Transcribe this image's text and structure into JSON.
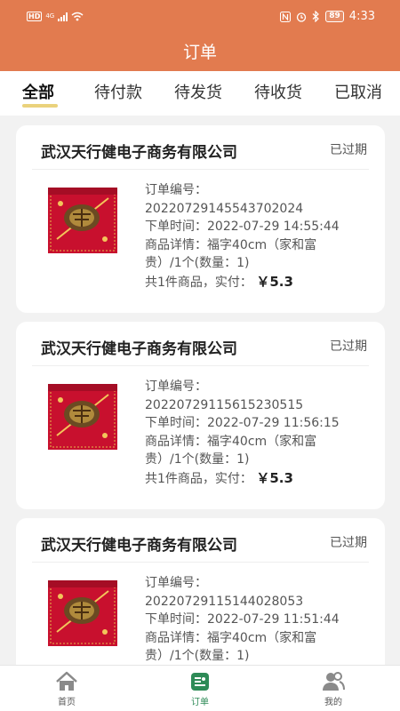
{
  "statusbar": {
    "network_badge": "HD",
    "network_type": "4G",
    "battery": "89",
    "time": "4:33"
  },
  "header": {
    "title": "订单"
  },
  "tabs": [
    {
      "label": "全部",
      "active": true
    },
    {
      "label": "待付款",
      "active": false
    },
    {
      "label": "待发货",
      "active": false
    },
    {
      "label": "待收货",
      "active": false
    },
    {
      "label": "已取消",
      "active": false
    }
  ],
  "orders": [
    {
      "shop": "武汉天行健电子商务有限公司",
      "status": "已过期",
      "order_no_label": "订单编号：",
      "order_no": "20220729145543702024",
      "time_label": "下单时间：",
      "time": "2022-07-29 14:55:44",
      "detail_label": "商品详情：",
      "detail_line1": "福字40cm（家和富",
      "detail_line2": "贵）/1个(数量：1)",
      "summary_label": "共1件商品，实付：",
      "price": "￥5.3"
    },
    {
      "shop": "武汉天行健电子商务有限公司",
      "status": "已过期",
      "order_no_label": "订单编号：",
      "order_no": "20220729115615230515",
      "time_label": "下单时间：",
      "time": "2022-07-29 11:56:15",
      "detail_label": "商品详情：",
      "detail_line1": "福字40cm（家和富",
      "detail_line2": "贵）/1个(数量：1)",
      "summary_label": "共1件商品，实付：",
      "price": "￥5.3"
    },
    {
      "shop": "武汉天行健电子商务有限公司",
      "status": "已过期",
      "order_no_label": "订单编号：",
      "order_no": "20220729115144028053",
      "time_label": "下单时间：",
      "time": "2022-07-29 11:51:44",
      "detail_label": "商品详情：",
      "detail_line1": "福字40cm（家和富",
      "detail_line2": "贵）/1个(数量：1)"
    }
  ],
  "tabbar": [
    {
      "label": "首页",
      "icon": "home-icon",
      "active": false
    },
    {
      "label": "订单",
      "icon": "order-list-icon",
      "active": true
    },
    {
      "label": "我的",
      "icon": "user-group-icon",
      "active": false
    }
  ],
  "colors": {
    "header_bg": "#e27b4f",
    "tab_underline": "#ead27c",
    "tabbar_active": "#2e8b57",
    "page_bg": "#f2f2f2"
  }
}
